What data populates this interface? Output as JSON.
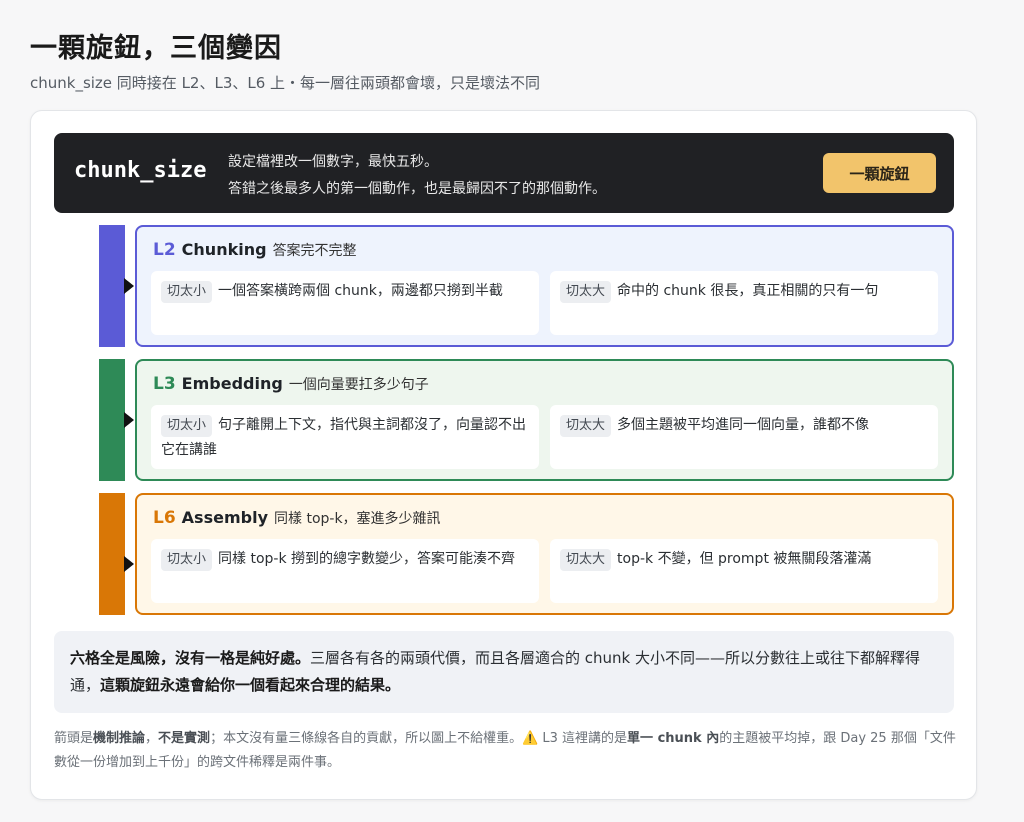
{
  "header": {
    "title": "一顆旋鈕，三個變因",
    "subtitle": "chunk_size 同時接在 L2、L3、L6 上・每一層往兩頭都會壞，只是壞法不同"
  },
  "knob": {
    "name": "chunk_size",
    "desc_line1": "設定檔裡改一個數字，最快五秒。",
    "desc_line2": "答錯之後最多人的第一個動作，也是最歸因不了的那個動作。",
    "badge": "一顆旋鈕"
  },
  "layers": [
    {
      "code": "L2",
      "name": "Chunking",
      "desc": "答案完不完整",
      "color": "#5b5bd6",
      "bg": "#eef3fd",
      "small_tag": "切太小",
      "small_text": "一個答案橫跨兩個 chunk，兩邊都只撈到半截",
      "large_tag": "切太大",
      "large_text": "命中的 chunk 很長，真正相關的只有一句"
    },
    {
      "code": "L3",
      "name": "Embedding",
      "desc": "一個向量要扛多少句子",
      "color": "#2e8a57",
      "bg": "#eef6ee",
      "small_tag": "切太小",
      "small_text": "句子離開上下文，指代與主詞都沒了，向量認不出它在講誰",
      "large_tag": "切太大",
      "large_text": "多個主題被平均進同一個向量，誰都不像"
    },
    {
      "code": "L6",
      "name": "Assembly",
      "desc": "同樣 top-k，塞進多少雜訊",
      "color": "#d97706",
      "bg": "#fff7e8",
      "small_tag": "切太小",
      "small_text": "同樣 top-k 撈到的總字數變少，答案可能湊不齊",
      "large_tag": "切太大",
      "large_text": "top-k 不變，但 prompt 被無關段落灌滿"
    }
  ],
  "summary": {
    "bold1": "六格全是風險，沒有一格是純好處。",
    "text1": "三層各有各的兩頭代價，而且各層適合的 chunk 大小不同——所以分數往上或往下都解釋得通，",
    "bold2": "這顆旋鈕永遠會給你一個看起來合理的結果。"
  },
  "footnote": {
    "part1": "箭頭是",
    "bold1": "機制推論",
    "part2": "，",
    "bold2": "不是實測",
    "part3": "；本文沒有量三條線各自的貢獻，所以圖上不給權重。",
    "icon": "warning-icon",
    "part4": " L3 這裡講的是",
    "bold3": "單一 chunk 內",
    "part5": "的主題被平均掉，跟 Day 25 那個「文件數從一份增加到上千份」的跨文件稀釋是兩件事。"
  }
}
